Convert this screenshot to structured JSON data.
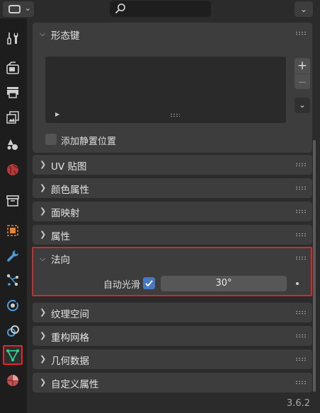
{
  "topbar": {
    "editor_type_icon": "properties-editor-icon",
    "search": {
      "value": "",
      "placeholder": ""
    },
    "menu_icon": "chevron-down-icon"
  },
  "sidebar": {
    "tabs": [
      {
        "name": "tool",
        "icon": "tool-icon"
      },
      {
        "name": "render",
        "icon": "render-camera-icon"
      },
      {
        "name": "output",
        "icon": "printer-icon"
      },
      {
        "name": "view-layer",
        "icon": "image-stack-icon"
      },
      {
        "name": "scene",
        "icon": "scene-icon"
      },
      {
        "name": "world",
        "icon": "globe-icon"
      },
      {
        "name": "collection",
        "icon": "box-icon"
      },
      {
        "name": "object",
        "icon": "object-cube-icon"
      },
      {
        "name": "modifiers",
        "icon": "wrench-icon"
      },
      {
        "name": "particles",
        "icon": "particles-icon"
      },
      {
        "name": "physics",
        "icon": "physics-orbit-icon"
      },
      {
        "name": "constraints",
        "icon": "constraint-icon"
      },
      {
        "name": "data",
        "icon": "mesh-triangle-icon",
        "active": true
      },
      {
        "name": "material",
        "icon": "material-sphere-icon"
      }
    ]
  },
  "panels": {
    "shape_keys": {
      "title": "形态键",
      "expanded": true,
      "relative_label": "添加静置位置",
      "relative_checked": false,
      "add_symbol": "+",
      "remove_symbol": "−"
    },
    "collapsed_top": [
      {
        "title": "UV 贴图"
      },
      {
        "title": "颜色属性"
      },
      {
        "title": "面映射"
      },
      {
        "title": "属性"
      }
    ],
    "normals": {
      "title": "法向",
      "expanded": true,
      "auto_smooth_label": "自动光滑",
      "auto_smooth_checked": true,
      "angle_value": "30°"
    },
    "collapsed_bottom": [
      {
        "title": "纹理空间"
      },
      {
        "title": "重构网格"
      },
      {
        "title": "几何数据"
      },
      {
        "title": "自定义属性"
      }
    ]
  },
  "footer": {
    "version": "3.6.2"
  },
  "colors": {
    "accent_highlight": "#d8262b",
    "checkbox_blue": "#4877c4",
    "active_tab_icon": "#2fd38e"
  }
}
